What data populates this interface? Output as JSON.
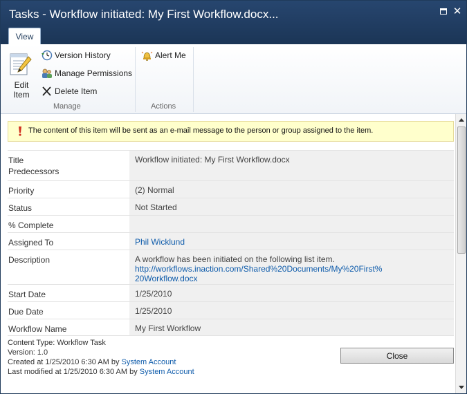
{
  "window": {
    "title": "Tasks - Workflow initiated: My First Workflow.docx..."
  },
  "ribbon": {
    "tab_label": "View",
    "edit_item_label": "Edit Item",
    "version_history_label": "Version History",
    "manage_permissions_label": "Manage Permissions",
    "delete_item_label": "Delete Item",
    "alert_me_label": "Alert Me",
    "group_manage_label": "Manage",
    "group_actions_label": "Actions"
  },
  "notice": {
    "text": "The content of this item will be sent as an e-mail message to the person or group assigned to the item."
  },
  "fields": {
    "title_label": "Title",
    "predecessors_label": "Predecessors",
    "title_value": "Workflow initiated:  My First Workflow.docx",
    "priority_label": "Priority",
    "priority_value": "(2) Normal",
    "status_label": "Status",
    "status_value": "Not Started",
    "complete_label": "% Complete",
    "complete_value": "",
    "assigned_label": "Assigned To",
    "assigned_value": "Phil Wicklund",
    "description_label": "Description",
    "description_text": "A workflow has been initiated on the following list item.",
    "description_link_line1": "http://workflows.inaction.com/Shared%20Documents/My%20First%",
    "description_link_line2": "20Workflow.docx",
    "start_label": "Start Date",
    "start_value": "1/25/2010",
    "due_label": "Due Date",
    "due_value": "1/25/2010",
    "workflow_name_label": "Workflow Name",
    "workflow_name_value": "My First Workflow"
  },
  "footer": {
    "content_type": "Content Type: Workflow Task",
    "version": "Version: 1.0",
    "created_prefix": "Created at 1/25/2010 6:30 AM  by ",
    "created_by": "System Account",
    "modified_prefix": "Last modified at 1/25/2010 6:30 AM  by ",
    "modified_by": "System Account"
  },
  "buttons": {
    "close_label": "Close"
  },
  "colors": {
    "title_bar": "#1b3556",
    "link": "#0f5cab",
    "notice_bg": "#ffffcc"
  }
}
